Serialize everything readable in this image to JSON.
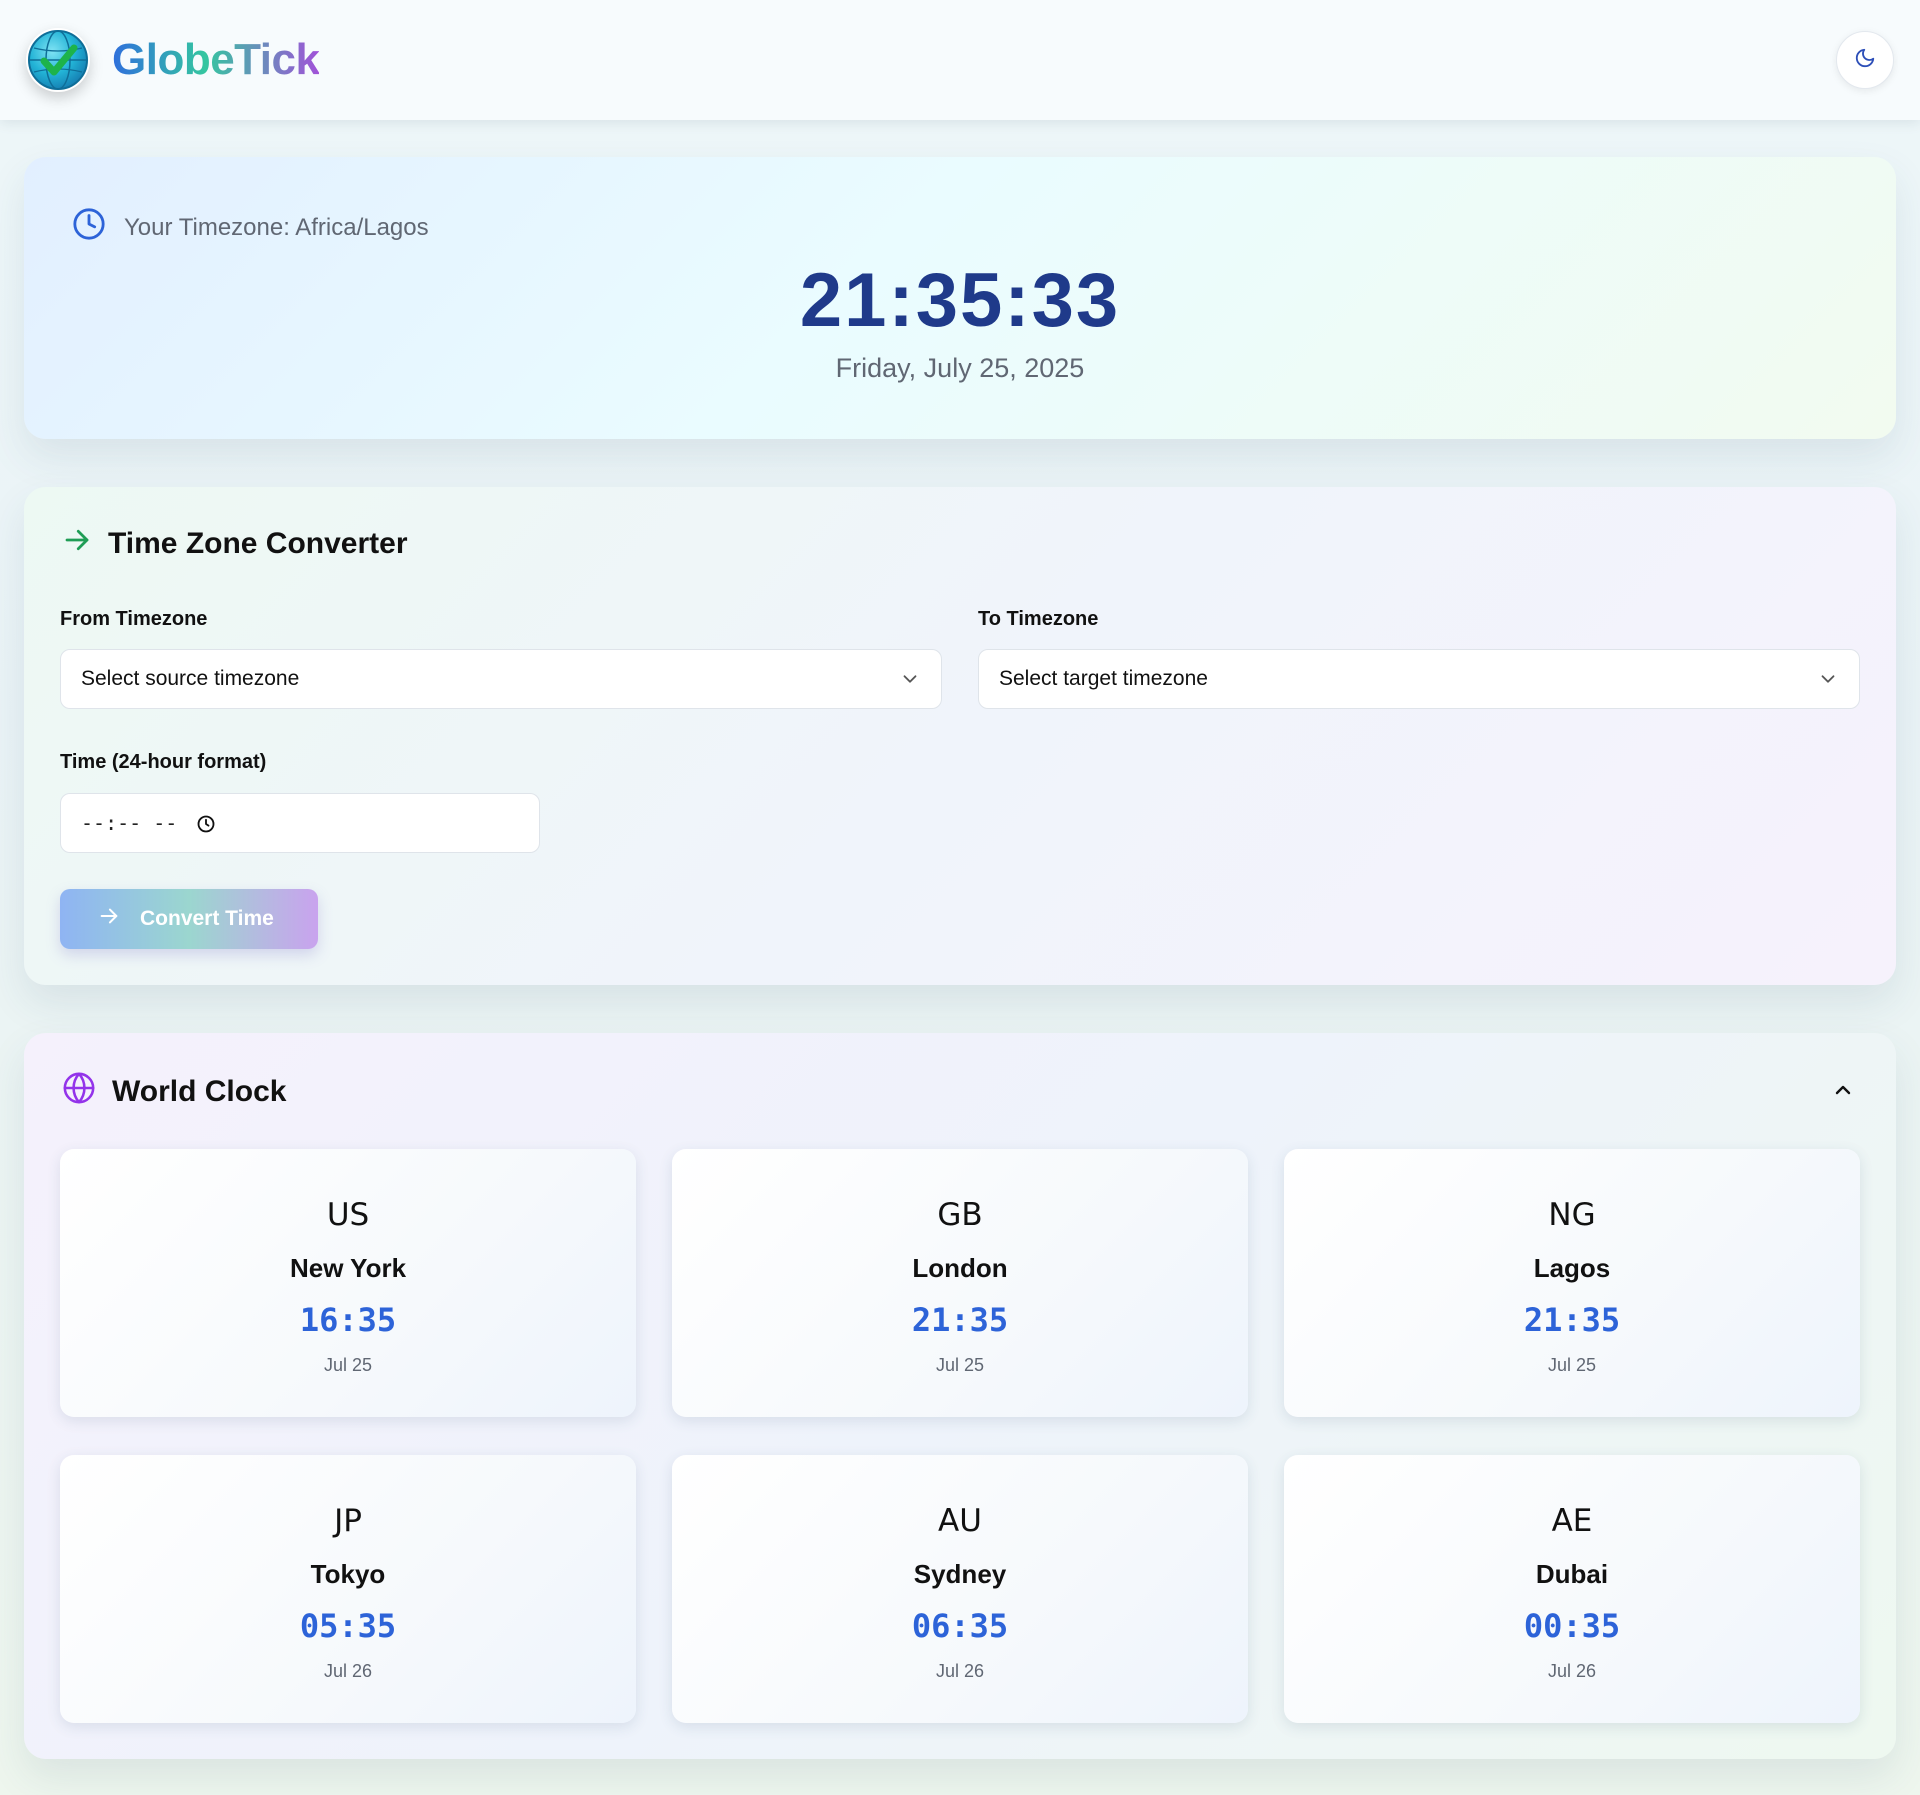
{
  "header": {
    "brand": "GlobeTick"
  },
  "current": {
    "timezone_label": "Your Timezone: Africa/Lagos",
    "time": "21:35:33",
    "date": "Friday, July 25, 2025"
  },
  "converter": {
    "title": "Time Zone Converter",
    "from_label": "From Timezone",
    "from_placeholder": "Select source timezone",
    "to_label": "To Timezone",
    "to_placeholder": "Select target timezone",
    "time_label": "Time (24-hour format)",
    "time_value": "--:-- --",
    "button_label": "Convert Time"
  },
  "world_clock": {
    "title": "World Clock",
    "cities": [
      {
        "code": "US",
        "name": "New York",
        "time": "16:35",
        "date": "Jul 25"
      },
      {
        "code": "GB",
        "name": "London",
        "time": "21:35",
        "date": "Jul 25"
      },
      {
        "code": "NG",
        "name": "Lagos",
        "time": "21:35",
        "date": "Jul 25"
      },
      {
        "code": "JP",
        "name": "Tokyo",
        "time": "05:35",
        "date": "Jul 26"
      },
      {
        "code": "AU",
        "name": "Sydney",
        "time": "06:35",
        "date": "Jul 26"
      },
      {
        "code": "AE",
        "name": "Dubai",
        "time": "00:35",
        "date": "Jul 26"
      }
    ]
  },
  "icons": {
    "logo": "globe-check-icon",
    "theme": "moon-icon",
    "timezone": "clock-icon",
    "converter": "arrow-right-icon",
    "world": "globe-icon",
    "collapse": "chevron-up-icon"
  },
  "colors": {
    "accent_blue": "#2d63d8",
    "clock_navy": "#1f3a8a",
    "converter_green": "#1f9d55",
    "world_purple": "#9333ea"
  }
}
